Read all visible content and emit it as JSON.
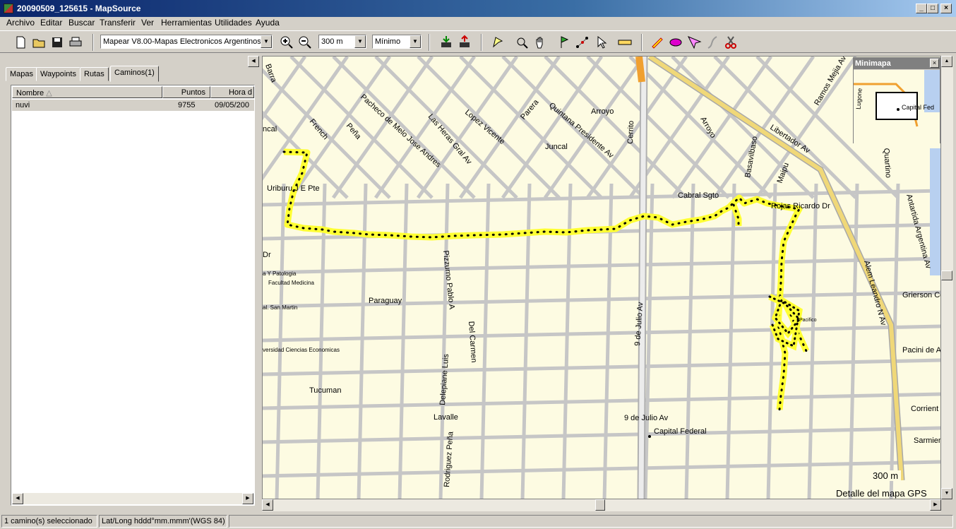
{
  "window": {
    "title": "20090509_125615 - MapSource"
  },
  "menu": [
    "Archivo",
    "Editar",
    "Buscar",
    "Transferir",
    "Ver",
    "Herramientas",
    "Utilidades",
    "Ayuda"
  ],
  "toolbar": {
    "map_product": "Mapear V8.00-Mapas Electronicos Argentinos",
    "zoom_scale": "300 m",
    "detail_level": "Mínimo"
  },
  "tabs": [
    {
      "label": "Mapas",
      "active": false
    },
    {
      "label": "Waypoints",
      "active": false
    },
    {
      "label": "Rutas",
      "active": false
    },
    {
      "label": "Caminos(1)",
      "active": true
    }
  ],
  "list": {
    "columns": [
      "Nombre",
      "Puntos",
      "Hora d"
    ],
    "rows": [
      {
        "name": "nuvi",
        "points": "9755",
        "time": "09/05/200"
      }
    ]
  },
  "map": {
    "street_labels": {
      "barra": "Barra",
      "ncal": "ncal",
      "french": "French",
      "pena": "Peña",
      "pacheco": "Pacheco de Melo Jose Andres",
      "lasheras": "Las Heras Gral Av",
      "lopez": "Lopez Vicente",
      "parera": "Parera",
      "quintana": "Quintana Presidente Av",
      "juncal": "Juncal",
      "arroyo1": "Arroyo",
      "arroyo2": "Arroyo",
      "cerrito": "Cerrito",
      "basavilbaso": "Basavilbaso",
      "maipu": "Maipu",
      "libertador": "Libertador Av",
      "ramos": "Ramos Mejia Av",
      "uriburu": "Uriburu J E Pte",
      "cabral": "Cabral Sgto",
      "rojas": "Rojas Ricardo Dr",
      "dr": "Dr",
      "patologia": "a Y Patologia",
      "medicina": "Facultad Medicina",
      "sanmartin": "al. San Martin",
      "economicas": "versidad Ciencias Economicas",
      "paraguay": "Paraguay",
      "pizzurno": "Pizzurno Pablo A",
      "delcarmen": "Del Carmen",
      "9julio1": "9 de Julio Av",
      "9julio2": "9 de Julio Av",
      "tucuman": "Tucuman",
      "lavalle": "Lavalle",
      "delepiane": "Delepiane Luis",
      "rodriguez": "Rodriguez Peña",
      "capital": "Capital Federal",
      "alem": "Alem Leandro N Av",
      "quartino": "Quartino",
      "antartida": "Antartida Argentina Av",
      "grierson": "Grierson Ce",
      "pacini": "Pacini de Alve",
      "corrien": "Corrient",
      "sarmien": "Sarmien",
      "pacifico": "Pacifico"
    },
    "scale_label": "300 m",
    "detail_caption": "Detalle del mapa GPS",
    "track_color": "#ffff33",
    "road_color": "#c6c6c6"
  },
  "minimap": {
    "title": "Minimapa",
    "label_lugones": "Lugone",
    "label_capital": "Capital Fed"
  },
  "status": {
    "selection": "1 camino(s) seleccionado",
    "coord_format": "Lat/Long hddd°mm.mmm'(WGS 84)"
  }
}
